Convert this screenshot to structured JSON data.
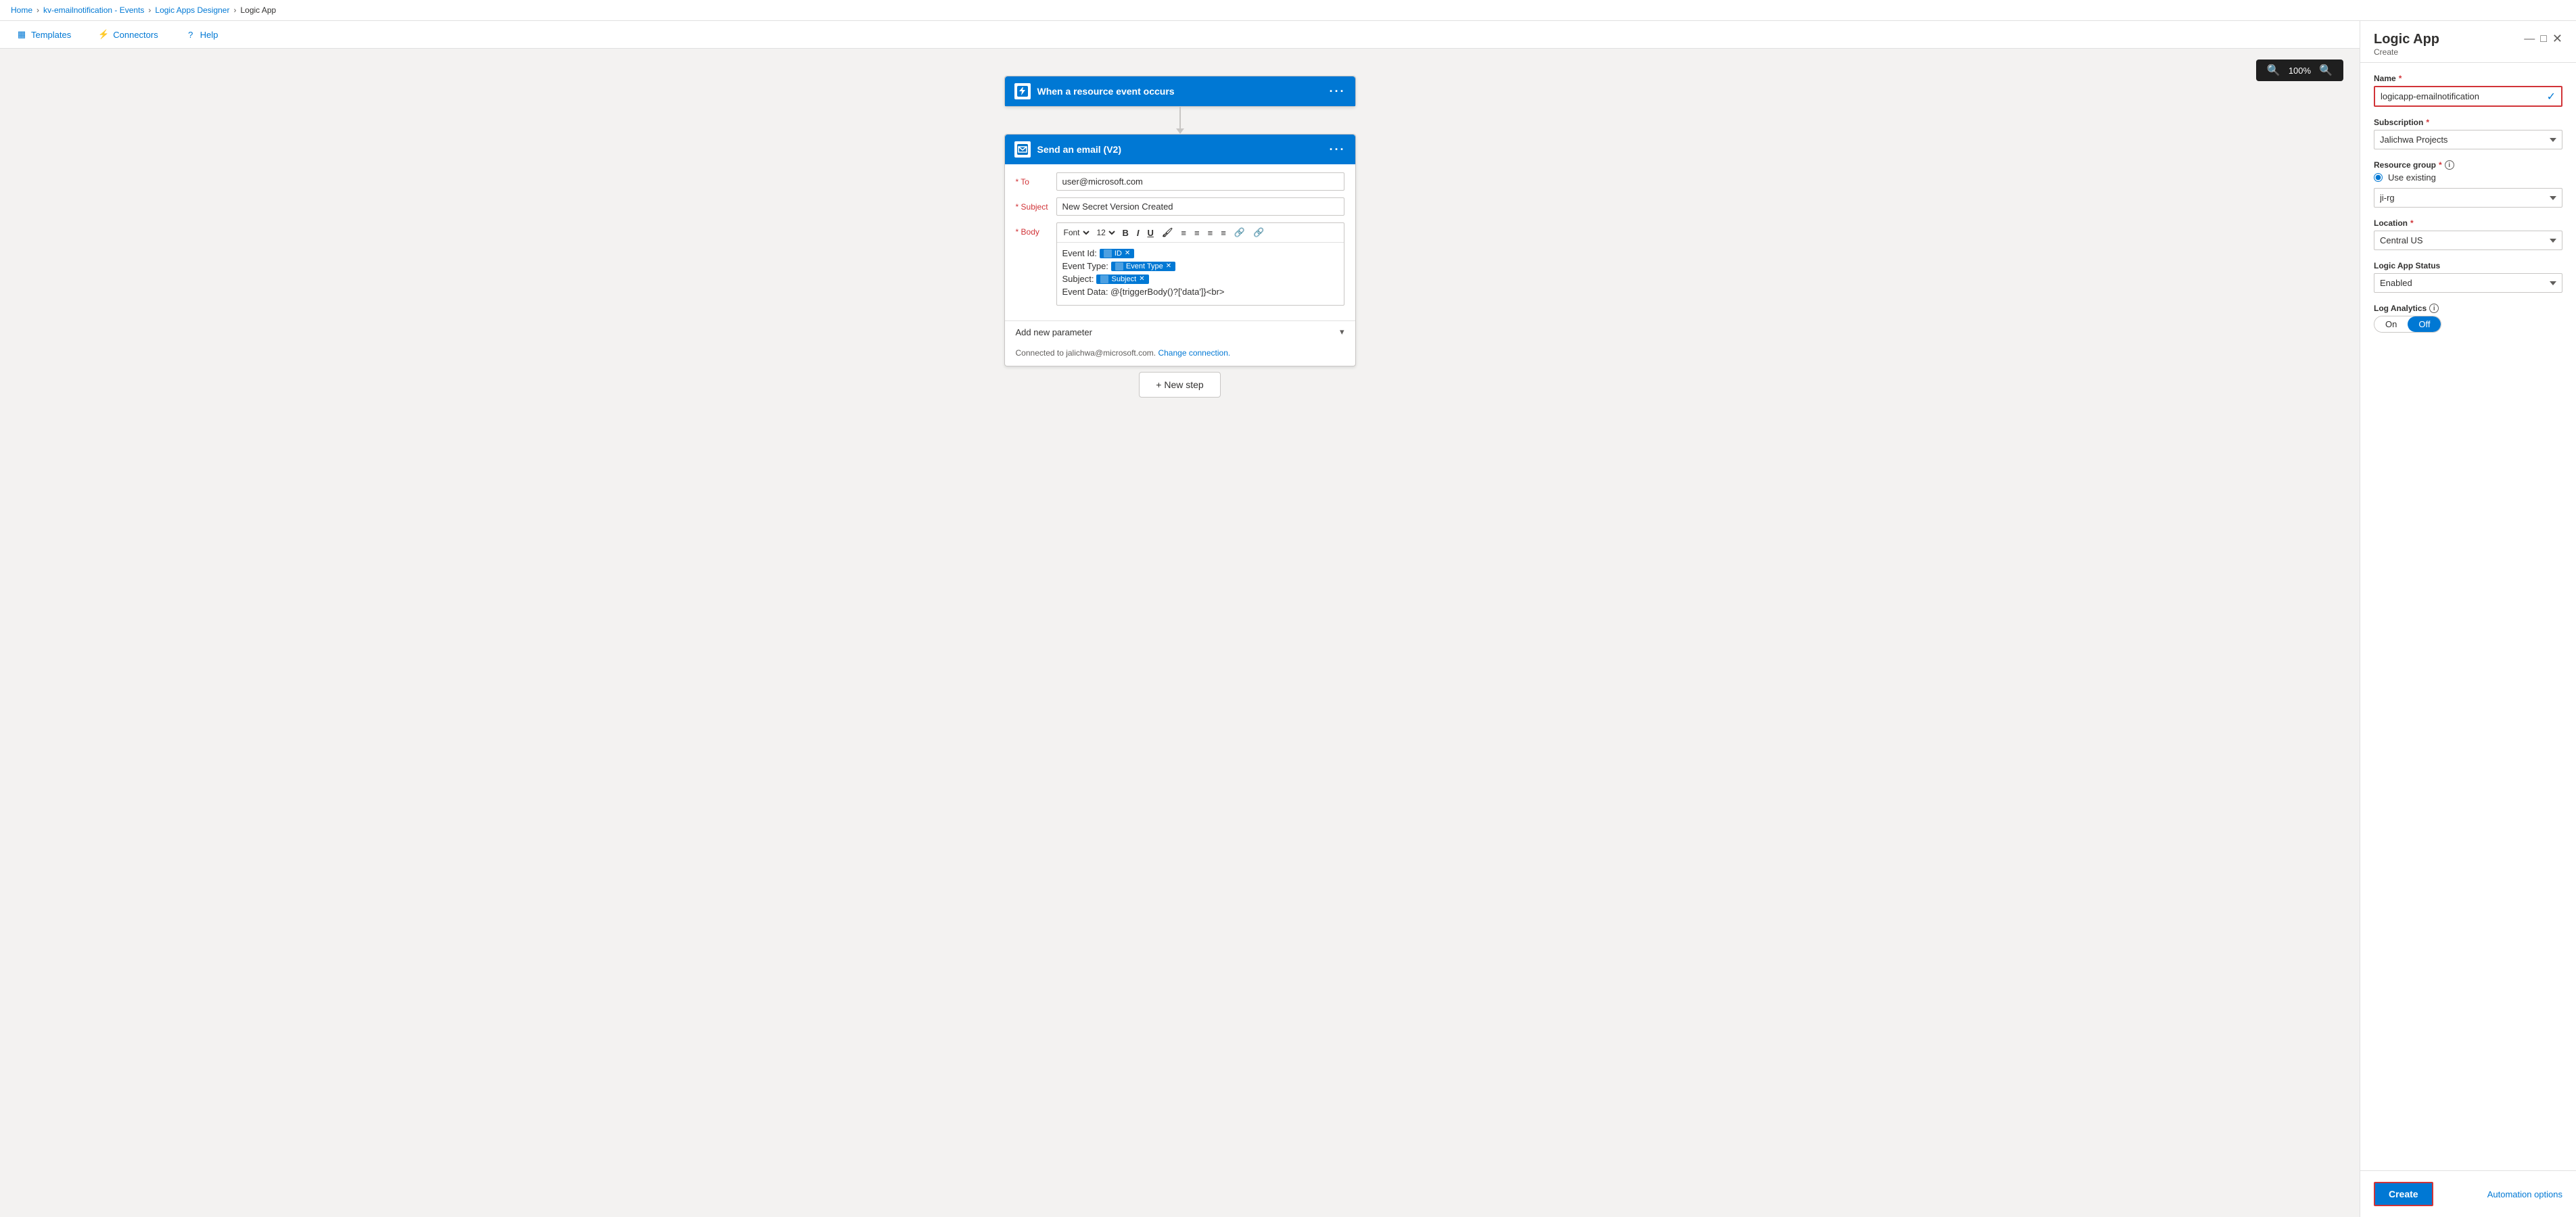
{
  "breadcrumb": {
    "items": [
      "Home",
      "kv-emailnotification - Events",
      "Logic Apps Designer",
      "Logic App"
    ]
  },
  "toolbar": {
    "templates_label": "Templates",
    "connectors_label": "Connectors",
    "help_label": "Help"
  },
  "zoom": {
    "level": "100%"
  },
  "flow": {
    "trigger": {
      "title": "When a resource event occurs",
      "icon_color": "#0078d4"
    },
    "action": {
      "title": "Send an email (V2)",
      "to_value": "user@microsoft.com",
      "to_placeholder": "user@microsoft.com",
      "subject_value": "New Secret Version Created",
      "body_tokens": {
        "event_id_label": "Event Id:",
        "event_id_token": "ID",
        "event_type_label": "Event Type:",
        "event_type_token": "Event Type",
        "subject_label": "Subject:",
        "subject_token": "Subject",
        "event_data_line": "Event Data: @{triggerBody()?['data']}<br>"
      },
      "font_family": "Font",
      "font_size": "12",
      "add_param_label": "Add new parameter",
      "connected_text": "Connected to jalichwa@microsoft.com.",
      "change_connection_label": "Change connection."
    },
    "new_step_label": "+ New step"
  },
  "panel": {
    "title": "Logic App",
    "subtitle": "Create",
    "name_label": "Name",
    "name_value": "logicapp-emailnotification",
    "subscription_label": "Subscription",
    "subscription_value": "Jalichwa Projects",
    "resource_group_label": "Resource group",
    "use_existing_label": "Use existing",
    "resource_group_value": "ji-rg",
    "location_label": "Location",
    "location_value": "Central US",
    "logic_app_status_label": "Logic App Status",
    "logic_app_status_value": "Enabled",
    "log_analytics_label": "Log Analytics",
    "log_on_label": "On",
    "log_off_label": "Off",
    "create_btn_label": "Create",
    "automation_options_label": "Automation options"
  },
  "icons": {
    "templates": "▦",
    "connectors": "⚡",
    "help": "?",
    "zoom_in": "🔍",
    "zoom_out": "🔍",
    "trigger_icon": "⚡",
    "email_icon": "✉",
    "bold": "B",
    "italic": "I",
    "underline": "U",
    "brush": "🖌",
    "bullet": "≡",
    "number": "≡",
    "align_left": "≡",
    "align_center": "≡",
    "link": "🔗",
    "unlink": "🔗",
    "chevron_down": "▾",
    "close": "✕",
    "check": "✓",
    "info": "i",
    "minimize": "—",
    "maximize": "□"
  }
}
